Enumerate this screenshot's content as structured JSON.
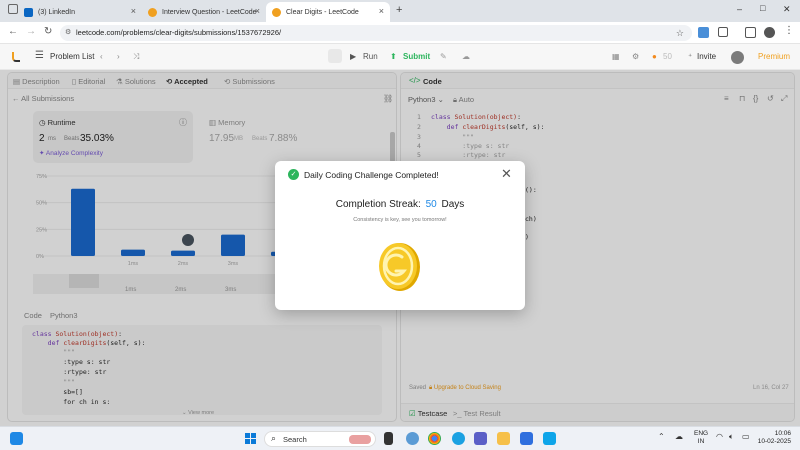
{
  "browser": {
    "tabs": [
      {
        "title": "(3) LinkedIn",
        "icon": "linkedin-icon",
        "color": "#0a66c2",
        "active": false
      },
      {
        "title": "Interview Question - LeetCode",
        "icon": "leetcode-icon",
        "color": "#f0a020",
        "active": false
      },
      {
        "title": "Clear Digits - LeetCode",
        "icon": "leetcode-icon",
        "color": "#f0a020",
        "active": true
      }
    ],
    "new_tab": "+",
    "url": "leetcode.com/problems/clear-digits/submissions/1537672926/",
    "window_controls": [
      "–",
      "□",
      "✕"
    ]
  },
  "leetcode_nav": {
    "problem_list": "Problem List",
    "run": "Run",
    "submit": "Submit",
    "streak_count": "50",
    "invite": "Invite",
    "premium": "Premium"
  },
  "left": {
    "tabs": [
      "Description",
      "Editorial",
      "Solutions",
      "Accepted",
      "Submissions"
    ],
    "all_submissions": "All Submissions",
    "runtime": {
      "label": "Runtime",
      "value": "2",
      "unit": "ms",
      "beats_label": "Beats",
      "beats": "35.03%",
      "analyze": "Analyze Complexity"
    },
    "memory": {
      "label": "Memory",
      "value": "17.95",
      "unit": "MB",
      "beats_label": "Beats",
      "beats": "7.88%"
    },
    "chart_axis": [
      "75%",
      "50%",
      "25%",
      "0%"
    ],
    "chart_x": [
      "1ms",
      "2ms",
      "3ms"
    ],
    "chart_x2": [
      "1ms",
      "2ms",
      "3ms"
    ],
    "code_label": "Code",
    "lang": "Python3",
    "code_lines": [
      "class Solution(object):",
      "    def clearDigits(self, s):",
      "        \"\"\"",
      "        :type s: str",
      "        :rtype: str",
      "        \"\"\"",
      "        sb=[]",
      "        for ch in s:"
    ],
    "show_more": "View more"
  },
  "right": {
    "title": "Code",
    "lang": "Python3",
    "auto": "Auto",
    "saved": "Saved",
    "upgrade": "Upgrade to Cloud Saving",
    "cursor_pos": "Ln 16, Col 27",
    "testcase": "Testcase",
    "test_result": "Test Result",
    "lines": [
      {
        "n": "1",
        "text": "class Solution(object):"
      },
      {
        "n": "2",
        "text": "    def clearDigits(self, s):"
      },
      {
        "n": "3",
        "text": "        \"\"\""
      },
      {
        "n": "4",
        "text": "        :type s: str"
      },
      {
        "n": "5",
        "text": "        :rtype: str"
      }
    ],
    "frag1": "():",
    "frag2": "ch)",
    "frag3": ")"
  },
  "modal": {
    "title": "Daily Coding Challenge Completed!",
    "streak_label": "Completion Streak:",
    "streak_value": "50",
    "streak_unit": "Days",
    "subtitle": "Consistency is key, see you tomorrow!"
  },
  "taskbar": {
    "search": "Search",
    "lang1": "ENG",
    "lang2": "IN",
    "time": "10:06",
    "date": "10-02-2025"
  },
  "chart_data": {
    "type": "bar",
    "categories": [
      "",
      "1ms",
      "2ms",
      "3ms",
      ""
    ],
    "values": [
      63,
      6,
      5,
      20,
      4
    ],
    "ylim": [
      0,
      75
    ],
    "grid": true
  }
}
